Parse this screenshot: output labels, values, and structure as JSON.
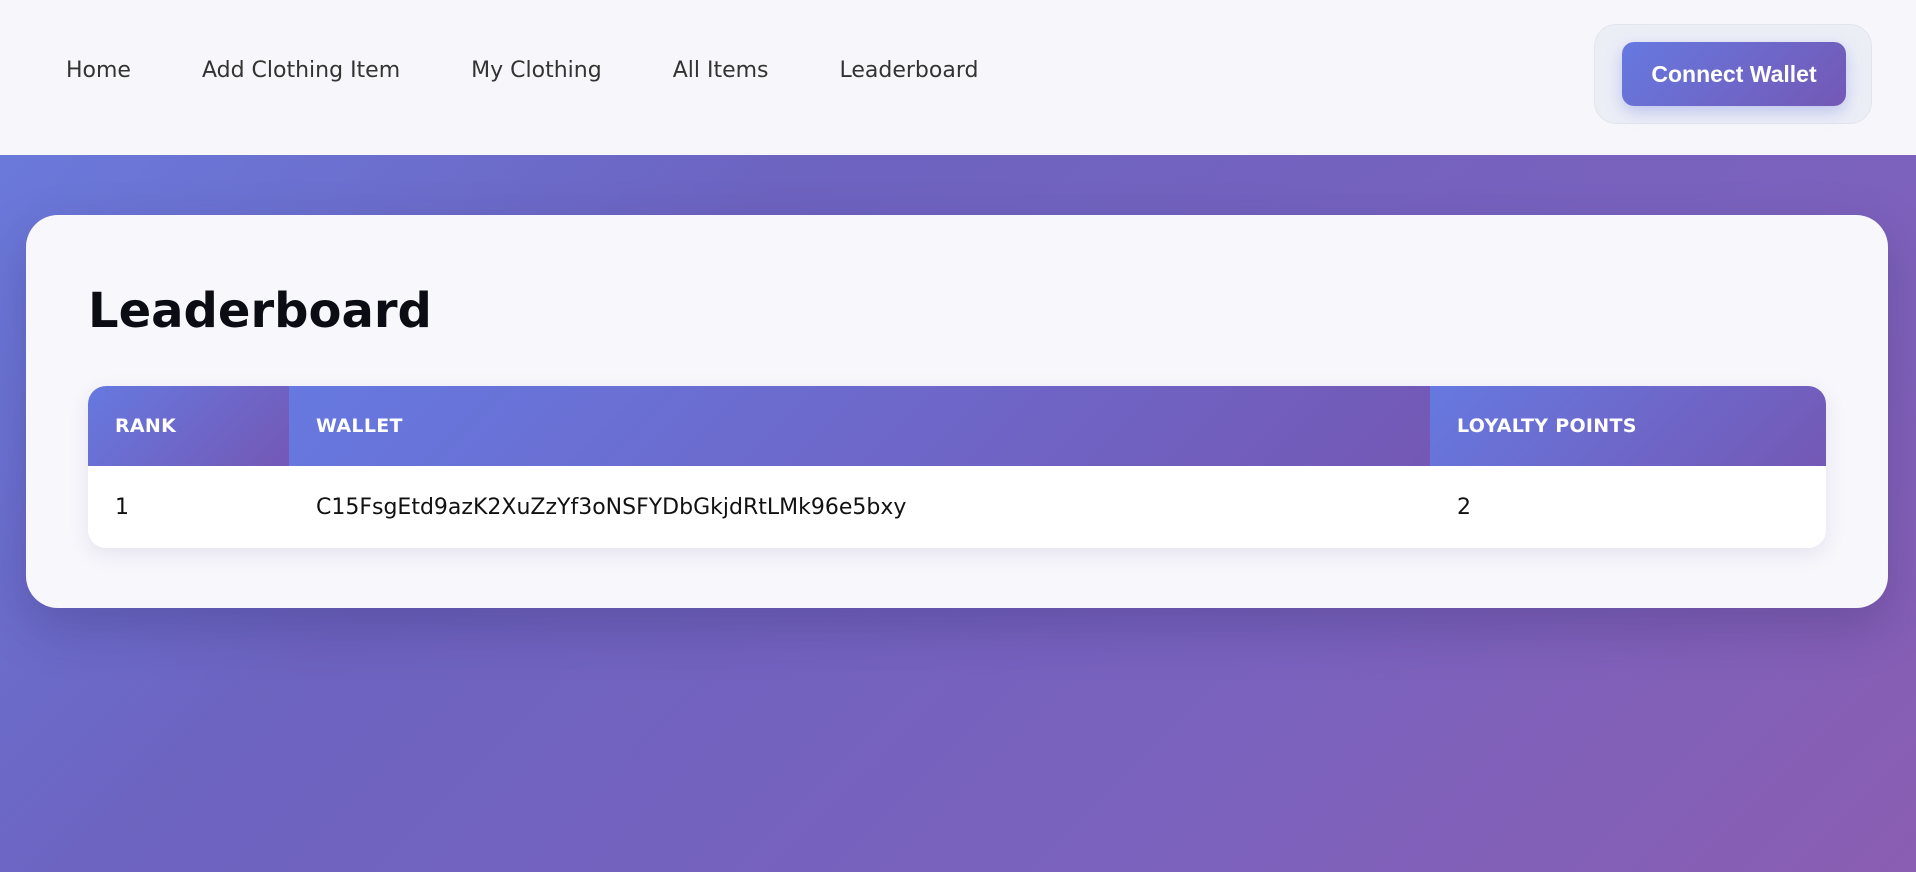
{
  "nav": {
    "items": [
      {
        "label": "Home"
      },
      {
        "label": "Add Clothing Item"
      },
      {
        "label": "My Clothing"
      },
      {
        "label": "All Items"
      },
      {
        "label": "Leaderboard"
      }
    ],
    "connect_wallet_label": "Connect Wallet"
  },
  "page": {
    "title": "Leaderboard"
  },
  "table": {
    "columns": [
      "RANK",
      "WALLET",
      "LOYALTY POINTS"
    ],
    "rows": [
      {
        "rank": "1",
        "wallet": "C15FsgEtd9azK2XuZzYf3oNSFYDbGkjdRtLMk96e5bxy",
        "points": "2"
      }
    ]
  },
  "colors": {
    "accent_start": "#6679e0",
    "accent_end": "#7458b5",
    "topbar_bg": "#f7f7fb",
    "card_bg": "#f8f7fc"
  }
}
